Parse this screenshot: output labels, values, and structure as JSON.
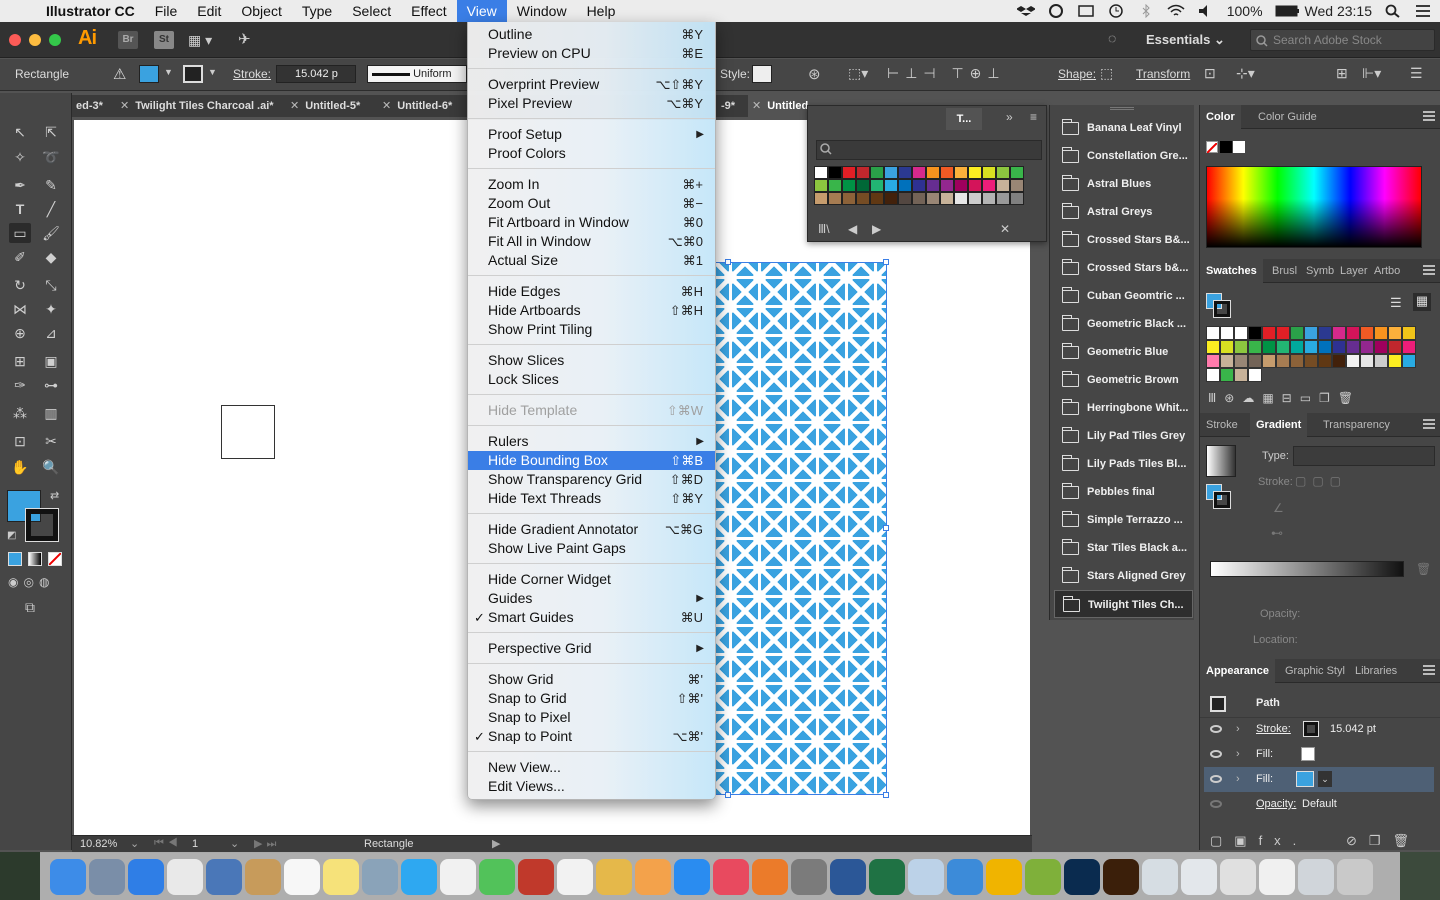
{
  "menubar": {
    "app_name": "Illustrator CC",
    "items": [
      "File",
      "Edit",
      "Object",
      "Type",
      "Select",
      "Effect",
      "View",
      "Window",
      "Help"
    ],
    "active_item": "View",
    "battery": "100%",
    "clock": "Wed 23:15"
  },
  "appbar": {
    "logo": "Ai",
    "bridge": "Br",
    "stock": "St",
    "workspace": "Essentials",
    "search_placeholder": "Search Adobe Stock"
  },
  "controlbar": {
    "object_type": "Rectangle",
    "stroke_label": "Stroke:",
    "stroke_value": "15.042 p",
    "profile": "Uniform",
    "style_label": "Style:",
    "shape_label": "Shape:",
    "transform_label": "Transform",
    "fill_color": "#3aa2e0"
  },
  "doc_tabs": [
    {
      "label": "ed-3*"
    },
    {
      "label": "Twilight Tiles Charcoal .ai*"
    },
    {
      "label": "Untitled-5*"
    },
    {
      "label": "Untitled-6*"
    },
    {
      "label": "-9*"
    },
    {
      "label": "Untitled"
    }
  ],
  "view_menu": {
    "groups": [
      [
        {
          "label": "Outline",
          "shortcut": "⌘Y"
        },
        {
          "label": "Preview on CPU",
          "shortcut": "⌘E"
        }
      ],
      [
        {
          "label": "Overprint Preview",
          "shortcut": "⌥⇧⌘Y"
        },
        {
          "label": "Pixel Preview",
          "shortcut": "⌥⌘Y"
        }
      ],
      [
        {
          "label": "Proof Setup",
          "submenu": true
        },
        {
          "label": "Proof Colors"
        }
      ],
      [
        {
          "label": "Zoom In",
          "shortcut": "⌘+"
        },
        {
          "label": "Zoom Out",
          "shortcut": "⌘−"
        },
        {
          "label": "Fit Artboard in Window",
          "shortcut": "⌘0"
        },
        {
          "label": "Fit All in Window",
          "shortcut": "⌥⌘0"
        },
        {
          "label": "Actual Size",
          "shortcut": "⌘1"
        }
      ],
      [
        {
          "label": "Hide Edges",
          "shortcut": "⌘H"
        },
        {
          "label": "Hide Artboards",
          "shortcut": "⇧⌘H"
        },
        {
          "label": "Show Print Tiling"
        }
      ],
      [
        {
          "label": "Show Slices"
        },
        {
          "label": "Lock Slices"
        }
      ],
      [
        {
          "label": "Hide Template",
          "shortcut": "⇧⌘W",
          "disabled": true
        }
      ],
      [
        {
          "label": "Rulers",
          "submenu": true
        },
        {
          "label": "Hide Bounding Box",
          "shortcut": "⇧⌘B",
          "highlighted": true
        },
        {
          "label": "Show Transparency Grid",
          "shortcut": "⇧⌘D"
        },
        {
          "label": "Hide Text Threads",
          "shortcut": "⇧⌘Y"
        }
      ],
      [
        {
          "label": "Hide Gradient Annotator",
          "shortcut": "⌥⌘G"
        },
        {
          "label": "Show Live Paint Gaps"
        }
      ],
      [
        {
          "label": "Hide Corner Widget"
        },
        {
          "label": "Guides",
          "submenu": true
        },
        {
          "label": "Smart Guides",
          "shortcut": "⌘U",
          "checked": true
        }
      ],
      [
        {
          "label": "Perspective Grid",
          "submenu": true
        }
      ],
      [
        {
          "label": "Show Grid",
          "shortcut": "⌘'"
        },
        {
          "label": "Snap to Grid",
          "shortcut": "⇧⌘'"
        },
        {
          "label": "Snap to Pixel"
        },
        {
          "label": "Snap to Point",
          "shortcut": "⌥⌘'",
          "checked": true
        }
      ],
      [
        {
          "label": "New View..."
        },
        {
          "label": "Edit Views..."
        }
      ]
    ]
  },
  "swatch_library_panel": {
    "tab": "T..."
  },
  "library_list": [
    "Banana Leaf Vinyl",
    "Constellation Gre...",
    "Astral Blues",
    "Astral Greys",
    "Crossed Stars B&...",
    "Crossed Stars b&...",
    "Cuban Geomtric ...",
    "Geometric Black ...",
    "Geometric Blue",
    "Geometric Brown",
    "Herringbone Whit...",
    "Lily Pad Tiles Grey",
    "Lily Pads Tiles Bl...",
    "Pebbles final",
    "Simple Terrazzo ...",
    "Star Tiles Black a...",
    "Stars Aligned Grey",
    "Twilight Tiles Ch..."
  ],
  "library_selected": "Twilight Tiles Ch...",
  "right_panels": {
    "color_tabs": [
      "Color",
      "Color Guide"
    ],
    "swatch_tabs": [
      "Swatches",
      "Brusl",
      "Symb",
      "Layer",
      "Artbo"
    ],
    "gradient_tabs": [
      "Stroke",
      "Gradient",
      "Transparency"
    ],
    "gradient": {
      "type_label": "Type:",
      "stroke_label": "Stroke:",
      "opacity_label": "Opacity:",
      "location_label": "Location:"
    },
    "appearance_tabs": [
      "Appearance",
      "Graphic Styl",
      "Libraries"
    ],
    "appearance": {
      "title": "Path",
      "stroke_label": "Stroke:",
      "stroke_value": "15.042 pt",
      "fill1_label": "Fill:",
      "fill2_label": "Fill:",
      "opacity_label": "Opacity:",
      "opacity_value": "Default"
    }
  },
  "statusbar": {
    "zoom": "10.82%",
    "artboard": "1",
    "tool": "Rectangle"
  },
  "colors": {
    "accent": "#3a7ee6",
    "pattern_blue": "#3aa2e0",
    "ai_orange": "#ff9a00"
  }
}
